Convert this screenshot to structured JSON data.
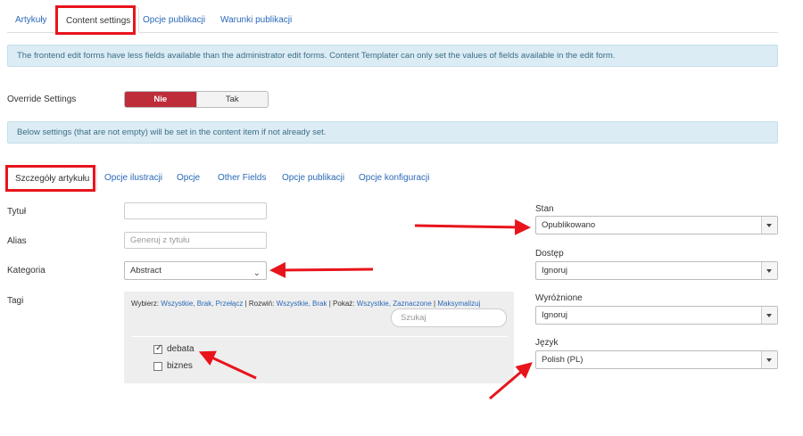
{
  "top_tabs": [
    "Artykuły",
    "Content settings",
    "Opcje publikacji",
    "Warunki publikacji"
  ],
  "alert1": "The frontend edit forms have less fields available than the administrator edit forms. Content Templater can only set the values of fields available in the edit form.",
  "override": {
    "label": "Override Settings",
    "no": "Nie",
    "yes": "Tak"
  },
  "alert2": "Below settings (that are not empty) will be set in the content item if not already set.",
  "sub_tabs": [
    "Szczegóły artykułu",
    "Opcje ilustracji",
    "Opcje",
    "Other Fields",
    "Opcje publikacji",
    "Opcje konfiguracji"
  ],
  "fields": {
    "title_label": "Tytuł",
    "title_value": "",
    "alias_label": "Alias",
    "alias_placeholder": "Generuj z tytułu",
    "category_label": "Kategoria",
    "category_value": "Abstract",
    "tags_label": "Tagi"
  },
  "tags": {
    "select_label": "Wybierz:",
    "select_all": "Wszystkie,",
    "select_none": "Brak,",
    "select_toggle": "Przełącz",
    "expand_label": "Rozwiń:",
    "expand_all": "Wszystkie,",
    "expand_none": "Brak",
    "show_label": "Pokaż:",
    "show_all": "Wszystkie,",
    "show_selected": "Zaznaczone",
    "maximize": "Maksymalizuj",
    "search_placeholder": "Szukaj",
    "items": [
      {
        "label": "debata",
        "checked": true
      },
      {
        "label": "biznes",
        "checked": false
      }
    ]
  },
  "right": {
    "state_label": "Stan",
    "state_value": "Opublikowano",
    "access_label": "Dostęp",
    "access_value": "Ignoruj",
    "featured_label": "Wyróżnione",
    "featured_value": "Ignoruj",
    "language_label": "Język",
    "language_value": "Polish (PL)"
  },
  "colors": {
    "accent_red": "#bd2d3a",
    "annotation_red": "#e8141c",
    "link_blue": "#2a69b8",
    "alert_bg": "#dcecf4"
  }
}
